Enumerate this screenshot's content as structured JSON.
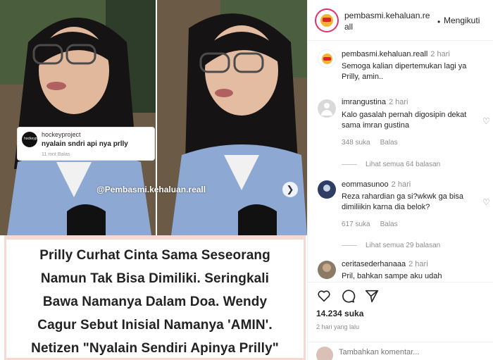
{
  "media": {
    "reply_card": {
      "avatar_label": "hockeyproject",
      "username": "hockeyproject",
      "text": "nyalain sndri api nya prlly",
      "meta": "11 mnt   Balas"
    },
    "watermark": "@Pembasmi.kehaluan.reall",
    "caption_lines": [
      "Prilly Curhat Cinta Sama Seseorang",
      "Namun Tak Bisa Dimiliki. Seringkali",
      "Bawa Namanya Dalam Doa. Wendy",
      "Cagur Sebut Inisial Namanya 'AMIN'.",
      "Netizen \"Nyalain Sendiri Apinya Prilly\""
    ]
  },
  "header": {
    "username": "pembasmi.kehaluan.re all",
    "dot": "•",
    "follow_label": "Mengikuti"
  },
  "comments": [
    {
      "username": "pembasmi.kehaluan.reall",
      "time": "2 hari",
      "text": "Semoga kalian dipertemukan lagi ya Prilly, amin.."
    },
    {
      "username": "imrangustina",
      "time": "2 hari",
      "text": "Kalo gasalah pernah digosipin dekat sama imran gustina",
      "likes": "348 suka",
      "reply_label": "Balas",
      "view_replies": "Lihat semua 64 balasan"
    },
    {
      "username": "eommasunoo",
      "time": "2 hari",
      "text": "Reza rahardian ga si?wkwk ga bisa dimiliikin karna dia belok?",
      "likes": "617 suka",
      "reply_label": "Balas",
      "view_replies": "Lihat semua 29 balasan"
    },
    {
      "username": "ceritasederhanaaa",
      "time": "2 hari",
      "text": "Pril, bahkan sampe aku udah"
    }
  ],
  "actions": {
    "likes": "14.234 suka",
    "posted": "2 hari yang lalu",
    "comment_placeholder": "Tambahkan komentar..."
  },
  "colors": {
    "caption_border": "#f7d9d3",
    "muted_text": "#8e8e8e",
    "story_ring": "#e1306c"
  }
}
